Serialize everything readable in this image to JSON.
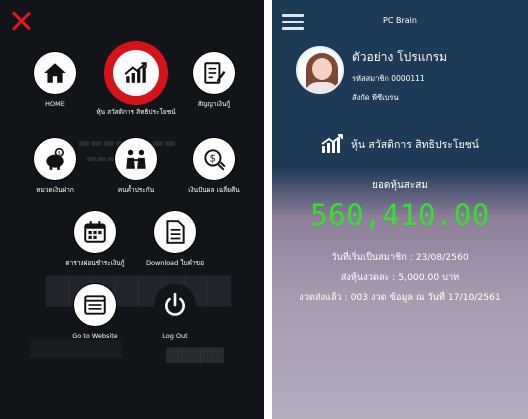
{
  "menu": {
    "items": [
      {
        "label": "HOME",
        "icon": "home-icon"
      },
      {
        "label": "หุ้น สวัสดิการ สิทธิประโยชน์",
        "icon": "chart-up-icon",
        "active": true
      },
      {
        "label": "สัญญาเงินกู้",
        "icon": "contract-icon"
      },
      {
        "label": "หมวดเงินฝาก",
        "icon": "piggy-bank-icon"
      },
      {
        "label": "คนค้ำประกัน",
        "icon": "guarantor-icon"
      },
      {
        "label": "เงินปันผล เฉลี่ยคืน",
        "icon": "dividend-icon"
      },
      {
        "label": "ตารางผ่อนชำระเงินกู้",
        "icon": "calendar-icon"
      },
      {
        "label": "Download ใบคำขอ",
        "icon": "document-icon"
      },
      {
        "label": "Go to Website",
        "icon": "website-icon"
      },
      {
        "label": "Log Out",
        "icon": "power-icon"
      }
    ],
    "accent_color": "#d4141a"
  },
  "dashboard": {
    "app_title": "PC Brain",
    "member_name": "ตัวอย่าง โปรแกรม",
    "member_id": "รหัสสมาชิก 0000111",
    "member_unit": "สังกัด พีซีเบรน",
    "section_title": "หุ้น สวัสดิการ สิทธิประโยชน์",
    "total_label": "ยอดหุ้นสะสม",
    "total_value": "560,410.00",
    "total_color": "#37e02c",
    "member_since": "วันที่เริ่มเป็นสมาชิก : 23/08/2560",
    "monthly_share": "ส่งหุ้นงวดละ : 5,000.00 บาท",
    "installments": "งวดส่งแล้ว : 003 งวด ข้อมูล ณ วันที่ 17/10/2561"
  }
}
